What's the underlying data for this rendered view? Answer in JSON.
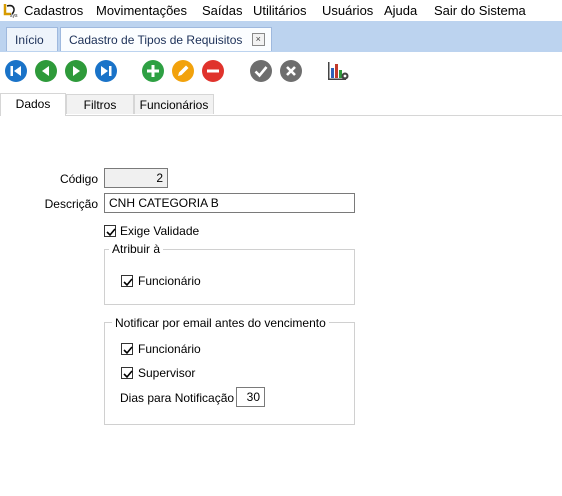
{
  "menu": {
    "items": [
      "Cadastros",
      "Movimentações",
      "Saídas",
      "Utilitários",
      "Usuários",
      "Ajuda",
      "Sair do Sistema"
    ]
  },
  "tabs": {
    "home": "Início",
    "current": "Cadastro de Tipos de Requisitos"
  },
  "toolbar": {
    "icons": [
      "first-icon",
      "previous-icon",
      "next-icon",
      "last-icon",
      "add-icon",
      "edit-icon",
      "delete-icon",
      "confirm-icon",
      "cancel-icon",
      "report-settings-icon"
    ],
    "colors": {
      "nav": "#1a73c8",
      "add": "#2ea043",
      "edit": "#f2a20c",
      "delete": "#e0332c",
      "gray": "#6e6e6e"
    }
  },
  "subtabs": {
    "dados": "Dados",
    "filtros": "Filtros",
    "funcionarios": "Funcionários"
  },
  "form": {
    "codigo_label": "Código",
    "codigo_value": "2",
    "descricao_label": "Descrição",
    "descricao_value": "CNH CATEGORIA B",
    "exige_validade": {
      "label": "Exige Validade",
      "checked": true
    },
    "atribuir": {
      "title": "Atribuir à",
      "funcionario": {
        "label": "Funcionário",
        "checked": true
      }
    },
    "notificar": {
      "title": "Notificar por email antes do vencimento",
      "funcionario": {
        "label": "Funcionário",
        "checked": true
      },
      "supervisor": {
        "label": "Supervisor",
        "checked": true
      },
      "dias_label": "Dias para Notificação",
      "dias_value": "30"
    }
  }
}
